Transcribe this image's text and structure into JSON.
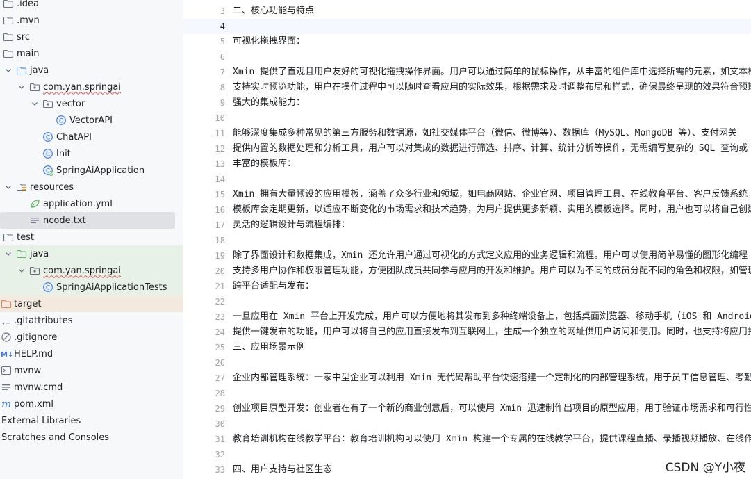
{
  "tree": [
    {
      "label": ".idea",
      "icon": "folder-icon",
      "level": 0,
      "chev": "none"
    },
    {
      "label": ".mvn",
      "icon": "folder-icon",
      "level": 0,
      "chev": "none"
    },
    {
      "label": "src",
      "icon": "folder-icon",
      "level": 0,
      "chev": "none"
    },
    {
      "label": "main",
      "icon": "folder-icon",
      "level": 0,
      "chev": "down"
    },
    {
      "label": "java",
      "icon": "source-folder-icon",
      "level": 1,
      "chev": "down"
    },
    {
      "label": "com.yan.springai",
      "icon": "package-icon",
      "level": 2,
      "chev": "down",
      "underline": true
    },
    {
      "label": "vector",
      "icon": "package-icon",
      "level": 3,
      "chev": "down"
    },
    {
      "label": "VectorAPI",
      "icon": "java-class-icon",
      "level": 4,
      "chev": "none"
    },
    {
      "label": "ChatAPI",
      "icon": "java-class-icon",
      "level": 3,
      "chev": "none"
    },
    {
      "label": "Init",
      "icon": "java-class-icon",
      "level": 3,
      "chev": "none"
    },
    {
      "label": "SpringAiApplication",
      "icon": "spring-boot-class-icon",
      "level": 3,
      "chev": "none"
    },
    {
      "label": "resources",
      "icon": "resources-folder-icon",
      "level": 1,
      "chev": "down"
    },
    {
      "label": "application.yml",
      "icon": "spring-yml-icon",
      "level": 2,
      "chev": "none"
    },
    {
      "label": "ncode.txt",
      "icon": "text-file-icon",
      "level": 2,
      "chev": "none",
      "selected": true
    },
    {
      "label": "test",
      "icon": "folder-icon",
      "level": 0,
      "chev": "down"
    },
    {
      "label": "java",
      "icon": "test-folder-icon",
      "level": 1,
      "chev": "down",
      "bg": "test"
    },
    {
      "label": "com.yan.springai",
      "icon": "package-icon",
      "level": 2,
      "chev": "down",
      "bg": "test",
      "underline": true
    },
    {
      "label": "SpringAiApplicationTests",
      "icon": "java-class-icon",
      "level": 3,
      "chev": "none",
      "bg": "test"
    },
    {
      "label": "target",
      "icon": "excluded-folder-icon",
      "level": -1,
      "chev": "none",
      "bg": "excluded"
    },
    {
      "label": ".gitattributes",
      "icon": "config-file-icon",
      "level": -1,
      "chev": "none"
    },
    {
      "label": ".gitignore",
      "icon": "ignore-file-icon",
      "level": -1,
      "chev": "none"
    },
    {
      "label": "HELP.md",
      "icon": "markdown-icon",
      "level": -1,
      "chev": "none"
    },
    {
      "label": "mvnw",
      "icon": "shell-script-icon",
      "level": -1,
      "chev": "none"
    },
    {
      "label": "mvnw.cmd",
      "icon": "text-file-icon",
      "level": -1,
      "chev": "none"
    },
    {
      "label": "pom.xml",
      "icon": "maven-icon",
      "level": -1,
      "chev": "none"
    },
    {
      "label": "External Libraries",
      "icon": "",
      "level": -2,
      "chev": "none"
    },
    {
      "label": "Scratches and Consoles",
      "icon": "",
      "level": -2,
      "chev": "none"
    }
  ],
  "editor": {
    "current_line": "4",
    "lines": [
      {
        "n": "3",
        "text": "二、核心功能与特点"
      },
      {
        "n": "4",
        "text": ""
      },
      {
        "n": "5",
        "text": "可视化拖拽界面："
      },
      {
        "n": "6",
        "text": ""
      },
      {
        "n": "7",
        "text": "Xmin 提供了直观且用户友好的可视化拖拽操作界面。用户可以通过简单的鼠标操作，从丰富的组件库中选择所需的元素，如文本框"
      },
      {
        "n": "8",
        "text": "支持实时预览功能，用户在操作过程中可以随时查看应用的实际效果，根据需求及时调整布局和样式，确保最终呈现的效果符合预期"
      },
      {
        "n": "9",
        "text": "强大的集成能力："
      },
      {
        "n": "10",
        "text": ""
      },
      {
        "n": "11",
        "text": "能够深度集成多种常见的第三方服务和数据源，如社交媒体平台（微信、微博等）、数据库（MySQL、MongoDB 等）、支付网关"
      },
      {
        "n": "12",
        "text": "提供内置的数据处理和分析工具，用户可以对集成的数据进行筛选、排序、计算、统计分析等操作，无需编写复杂的 SQL 查询或"
      },
      {
        "n": "13",
        "text": "丰富的模板库："
      },
      {
        "n": "14",
        "text": ""
      },
      {
        "n": "15",
        "text": "Xmin 拥有大量预设的应用模板，涵盖了众多行业和领域，如电商网站、企业官网、项目管理工具、在线教育平台、客户反馈系统"
      },
      {
        "n": "16",
        "text": "模板库会定期更新，以适应不断变化的市场需求和技术趋势，为用户提供更多新颖、实用的模板选择。同时，用户也可以将自己创建"
      },
      {
        "n": "17",
        "text": "灵活的逻辑设计与流程编排："
      },
      {
        "n": "18",
        "text": ""
      },
      {
        "n": "19",
        "text": "除了界面设计和数据集成，Xmin 还允许用户通过可视化的方式定义应用的业务逻辑和流程。用户可以使用简单易懂的图形化编程"
      },
      {
        "n": "20",
        "text": "支持多用户协作和权限管理功能，方便团队成员共同参与应用的开发和维护。用户可以为不同的成员分配不同的角色和权限，如管理"
      },
      {
        "n": "21",
        "text": "跨平台适配与发布："
      },
      {
        "n": "22",
        "text": ""
      },
      {
        "n": "23",
        "text": "一旦应用在 Xmin 平台上开发完成，用户可以方便地将其发布到多种终端设备上，包括桌面浏览器、移动手机（iOS 和 Android"
      },
      {
        "n": "24",
        "text": "提供一键发布的功能，用户可以将自己的应用直接发布到互联网上，生成一个独立的网址供用户访问和使用。同时，也支持将应用打"
      },
      {
        "n": "25",
        "text": "三、应用场景示例"
      },
      {
        "n": "26",
        "text": ""
      },
      {
        "n": "27",
        "text": "企业内部管理系统：一家中型企业可以利用 Xmin 无代码帮助平台快速搭建一个定制化的内部管理系统，用于员工信息管理、考勤"
      },
      {
        "n": "28",
        "text": ""
      },
      {
        "n": "29",
        "text": "创业项目原型开发：创业者在有了一个新的商业创意后，可以使用 Xmin 迅速制作出项目的原型应用，用于验证市场需求和可行性"
      },
      {
        "n": "30",
        "text": ""
      },
      {
        "n": "31",
        "text": "教育培训机构在线教学平台：教育培训机构可以使用 Xmin 构建一个专属的在线教学平台，提供课程直播、录播视频播放、在线作"
      },
      {
        "n": "32",
        "text": ""
      },
      {
        "n": "33",
        "text": "四、用户支持与社区生态"
      }
    ]
  },
  "watermark": "CSDN @Y小夜"
}
